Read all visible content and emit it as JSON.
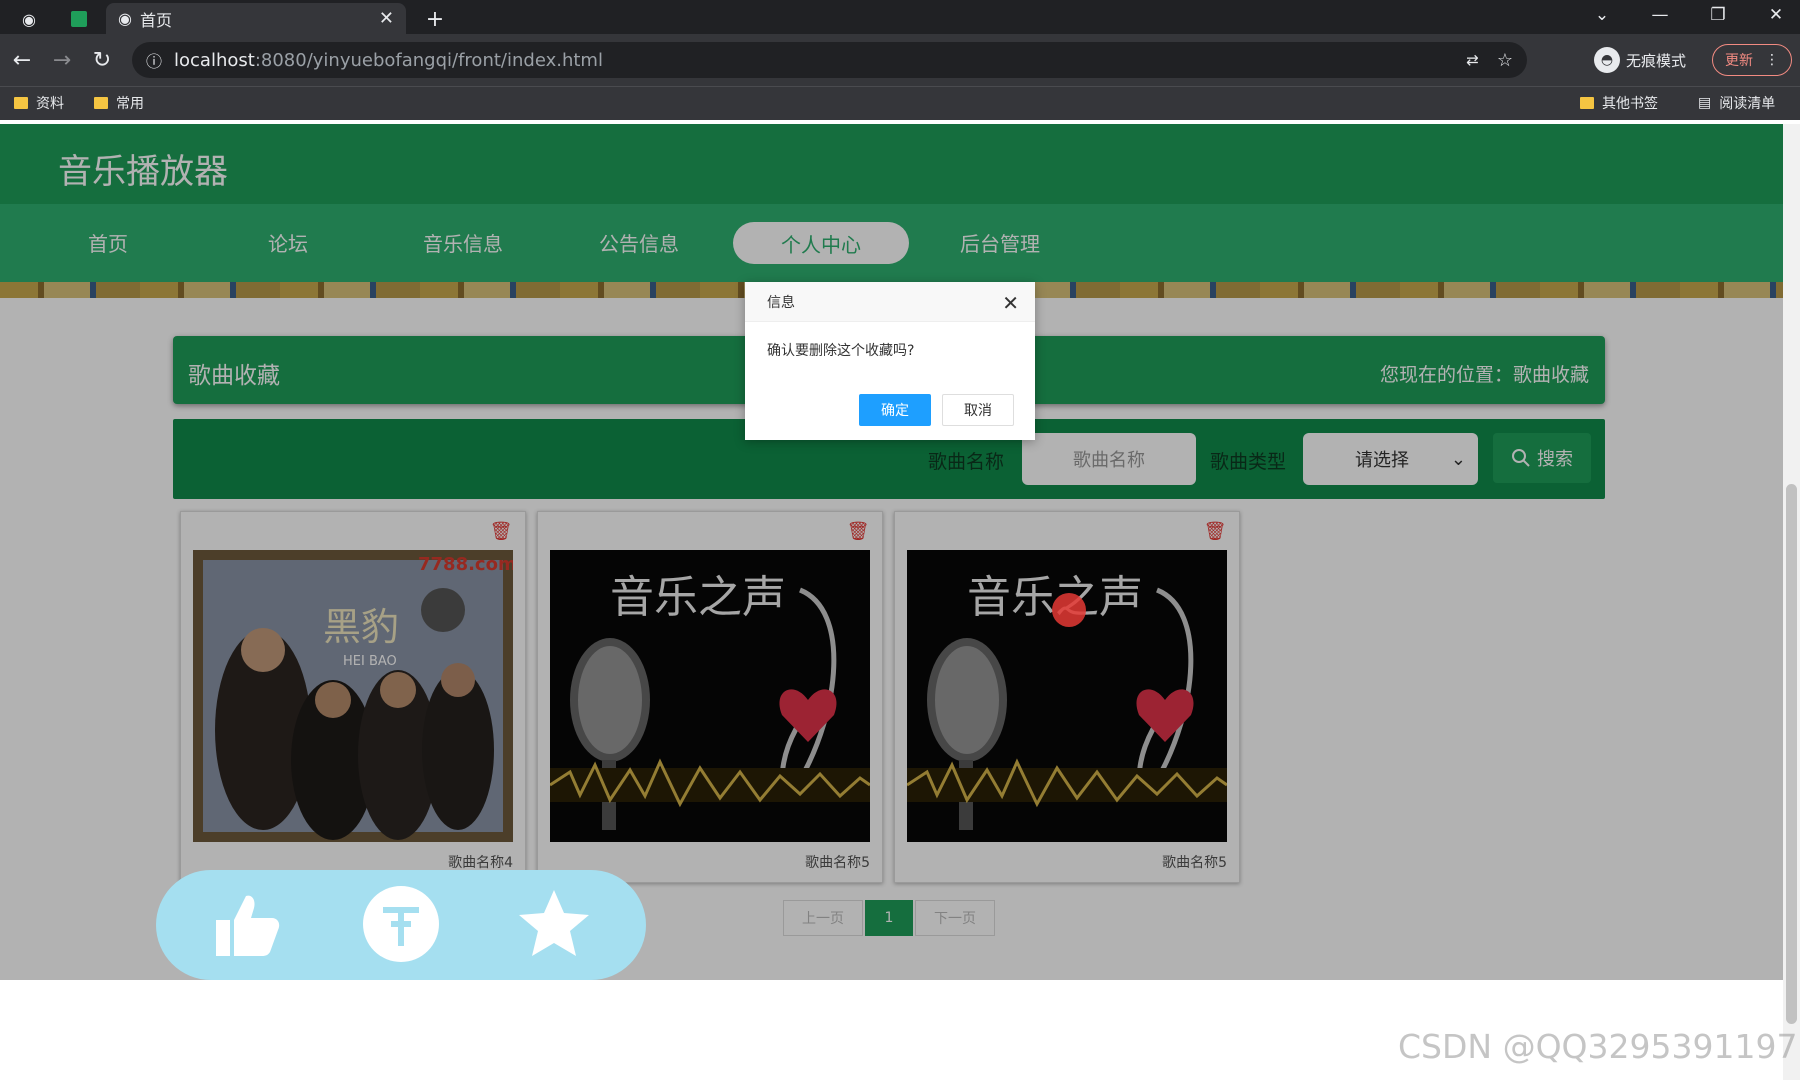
{
  "browser": {
    "tab_title": "首页",
    "url_host": "localhost",
    "url_path": ":8080/yinyuebofangqi/front/index.html",
    "incognito_label": "无痕模式",
    "update_label": "更新",
    "bookmarks": [
      "资料",
      "常用"
    ],
    "bookmarks_right": [
      "其他书签",
      "阅读清单"
    ]
  },
  "site": {
    "title": "音乐播放器",
    "nav": [
      "首页",
      "论坛",
      "音乐信息",
      "公告信息",
      "个人中心",
      "后台管理"
    ],
    "active_nav": "个人中心"
  },
  "collection": {
    "heading": "歌曲收藏",
    "location": "您现在的位置：歌曲收藏",
    "search_name_label": "歌曲名称",
    "search_name_placeholder": "歌曲名称",
    "search_type_label": "歌曲类型",
    "search_type_value": "请选择",
    "search_button": "搜索",
    "cards": [
      {
        "name": "歌曲名称4",
        "cover": "hei-bao"
      },
      {
        "name": "歌曲名称5",
        "cover": "music-voice"
      },
      {
        "name": "歌曲名称5",
        "cover": "music-voice"
      }
    ],
    "pager": {
      "prev": "上一页",
      "current": "1",
      "next": "下一页"
    }
  },
  "dialog": {
    "title": "信息",
    "message": "确认要删除这个收藏吗?",
    "ok": "确定",
    "cancel": "取消"
  },
  "cover_text": {
    "site_mark": "7788.com",
    "band": "黑豹",
    "band_en": "HEI BAO",
    "music_voice": "音乐之声"
  },
  "watermark": "CSDN @QQ3295391197",
  "colors": {
    "header": "#1f9e5a",
    "nav": "#2fb070",
    "dialog_ok": "#1e9fff"
  }
}
